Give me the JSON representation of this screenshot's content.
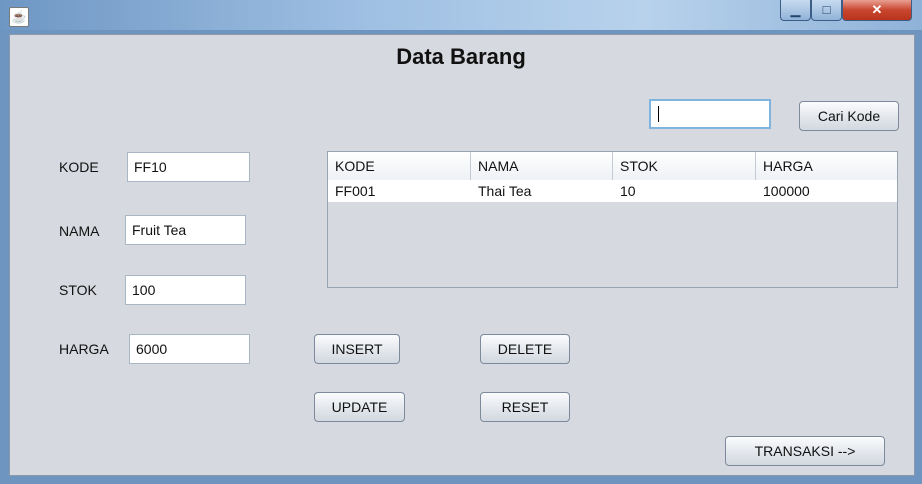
{
  "window": {
    "app_icon": "java-icon",
    "controls": {
      "minimize": "▁",
      "maximize": "□",
      "close": "✕"
    }
  },
  "page_title": "Data Barang",
  "search": {
    "value": "",
    "button_label": "Cari Kode"
  },
  "form": {
    "kode_label": "KODE",
    "kode_value": "FF10",
    "nama_label": "NAMA",
    "nama_value": "Fruit Tea",
    "stok_label": "STOK",
    "stok_value": "100",
    "harga_label": "HARGA",
    "harga_value": "6000"
  },
  "table": {
    "columns": [
      "KODE",
      "NAMA",
      "STOK",
      "HARGA"
    ],
    "rows": [
      [
        "FF001",
        "Thai Tea",
        "10",
        "100000"
      ]
    ]
  },
  "buttons": {
    "insert": "INSERT",
    "delete": "DELETE",
    "update": "UPDATE",
    "reset": "RESET",
    "transaksi": "TRANSAKSI -->"
  }
}
